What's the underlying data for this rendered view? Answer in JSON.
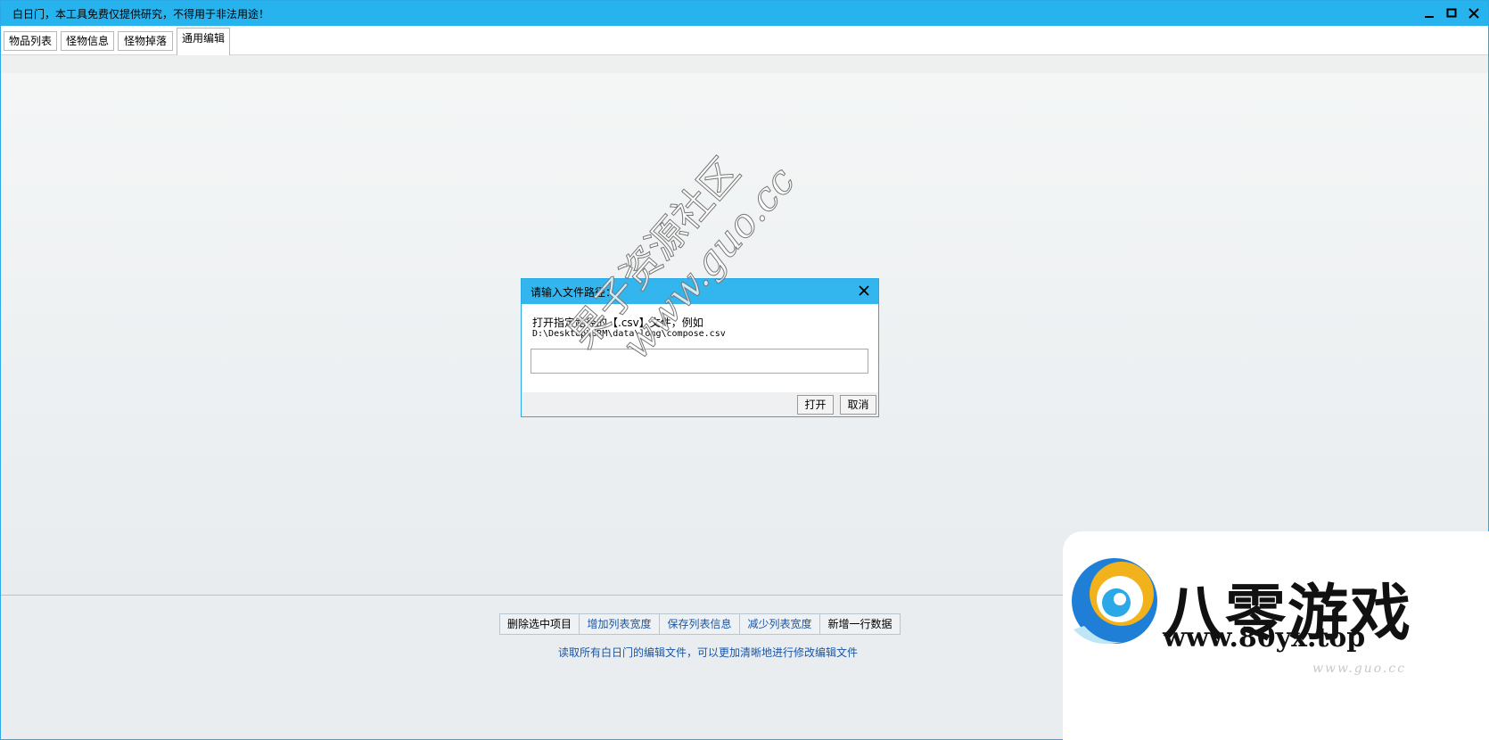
{
  "window": {
    "title": "白日门，本工具免费仅提供研究，不得用于非法用途！",
    "controls": [
      "minimize",
      "maximize",
      "close"
    ]
  },
  "tabs": [
    {
      "label": "物品列表"
    },
    {
      "label": "怪物信息"
    },
    {
      "label": "怪物掉落"
    },
    {
      "label": "通用编辑",
      "active": true
    }
  ],
  "actions": [
    {
      "label": "删除选中项目"
    },
    {
      "label": "增加列表宽度"
    },
    {
      "label": "保存列表信息"
    },
    {
      "label": "减少列表宽度"
    },
    {
      "label": "新增一行数据"
    }
  ],
  "info_text": "读取所有白日门的编辑文件，可以更加清晰地进行修改编辑文件",
  "dialog": {
    "title": "请输入文件路径：",
    "message_line1": "打开指定路径的【.csv】文件，例如",
    "message_line2": "D:\\Desktop\\BRM\\data\\long\\compose.csv",
    "input_value": "",
    "open_label": "打开",
    "cancel_label": "取消"
  },
  "watermark": {
    "line1": "果子资源社区",
    "line2": "www.guo.cc"
  },
  "brand": {
    "name": "八零游戏",
    "url": "www.80yx.top",
    "url2": "www.guo.cc"
  },
  "colors": {
    "titlebar": "#27b3ee",
    "dialog_title": "#33b5ee",
    "link_text": "#1a56a8"
  }
}
